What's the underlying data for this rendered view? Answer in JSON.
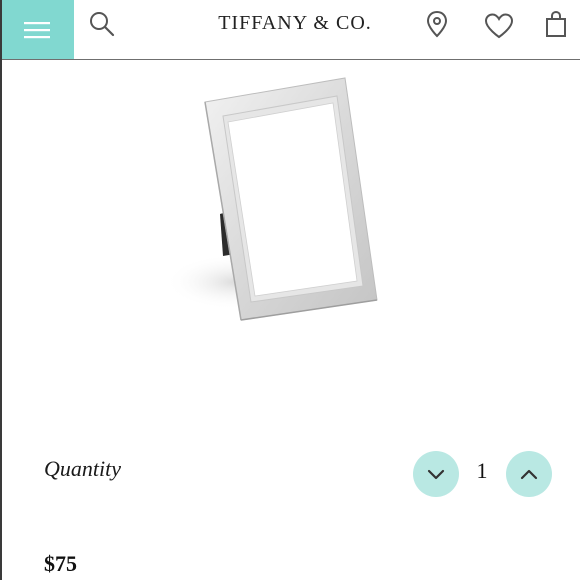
{
  "header": {
    "brand": "TIFFANY & CO.",
    "menu_icon": "hamburger-menu-icon",
    "search_icon": "search-icon",
    "location_icon": "location-pin-icon",
    "wishlist_icon": "heart-icon",
    "bag_icon": "shopping-bag-icon",
    "accent_color": "#81d8d0"
  },
  "product": {
    "image_description_icon": "silver-picture-frame-image"
  },
  "quantity": {
    "label": "Quantity",
    "value": "1",
    "decrease_icon": "chevron-down-icon",
    "increase_icon": "chevron-up-icon",
    "button_color": "#b9e8e3"
  },
  "price": {
    "amount": "$75"
  }
}
